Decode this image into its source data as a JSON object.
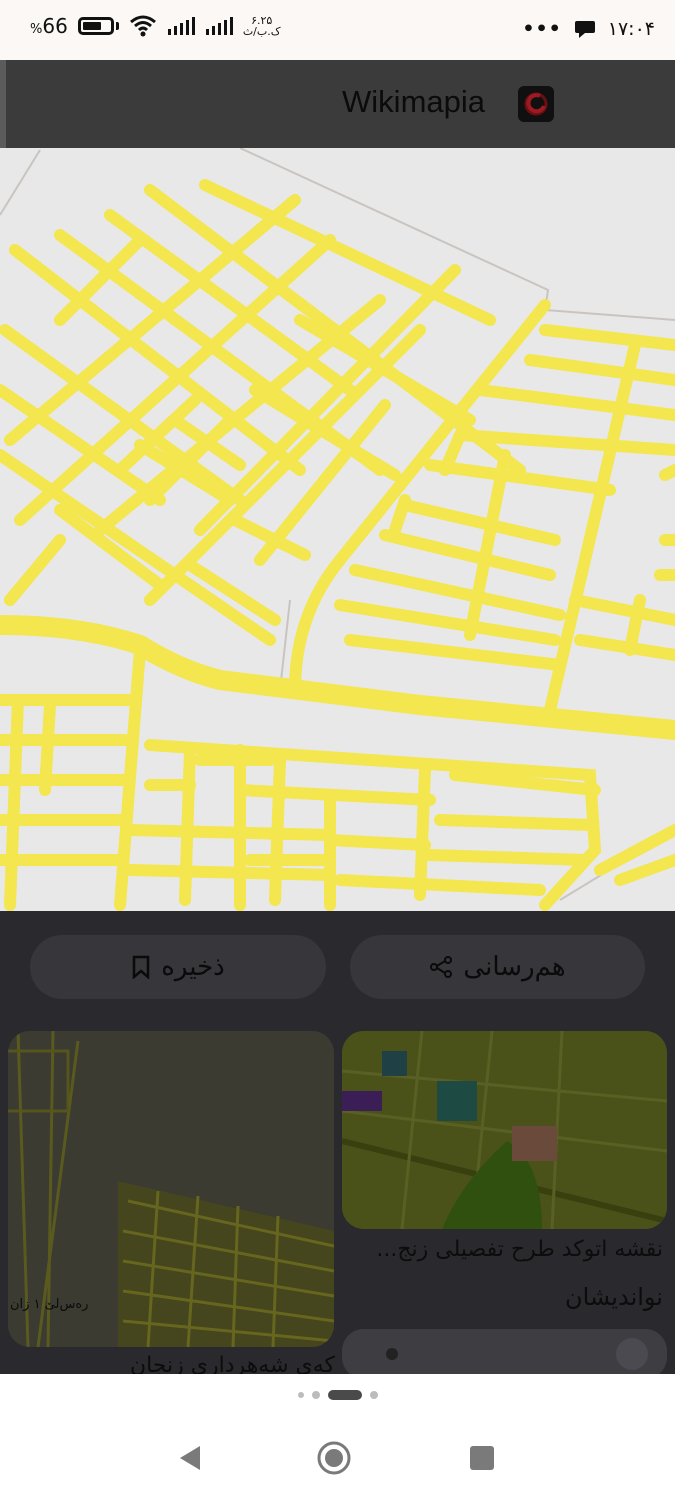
{
  "status_bar": {
    "time": "۱۷:۰۴",
    "more_indicator": "•••",
    "battery": "66",
    "battery_percent_sign": "%",
    "battery_level": 0.66,
    "net_speed": "۶.۲۵",
    "net_unit": "ک.ب/ث",
    "icons": [
      "chat-bubble-icon",
      "wifi-icon",
      "signal-icon",
      "signal-icon",
      "battery-icon"
    ]
  },
  "app_bar": {
    "title": "Wikimapia",
    "icon": "app-logo-icon"
  },
  "actions": {
    "share_label": "هم‌رسانی",
    "save_label": "ذخیره"
  },
  "results": [
    {
      "title": "نقشه اتوکد طرح تفصیلی زنج...",
      "source": "نواندیشان"
    },
    {
      "title": "کەی شەهرداری زنجان",
      "source": ""
    },
    {
      "title": "",
      "source": ""
    }
  ],
  "map_label": "رەس‌لێ ۱ زان",
  "pager": {
    "count": 4,
    "active_index": 2
  },
  "nav": {
    "icons": [
      "back-icon",
      "home-icon",
      "recents-icon"
    ]
  },
  "colors": {
    "road": "#f6e85a",
    "map_bg": "#e8e8e8",
    "overlay": "#2a2a2e"
  }
}
